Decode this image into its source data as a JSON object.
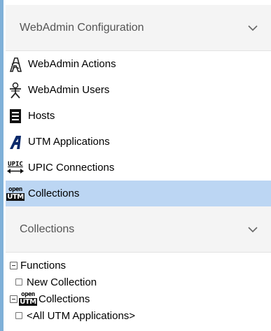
{
  "config_section": {
    "title": "WebAdmin Configuration",
    "items": [
      {
        "label": "WebAdmin Actions",
        "icon": "webadmin-actions-icon"
      },
      {
        "label": "WebAdmin Users",
        "icon": "webadmin-users-icon"
      },
      {
        "label": "Hosts",
        "icon": "hosts-icon"
      },
      {
        "label": "UTM Applications",
        "icon": "utm-applications-icon"
      },
      {
        "label": "UPIC Connections",
        "icon": "upic-connections-icon"
      },
      {
        "label": "Collections",
        "icon": "openutm-collections-icon",
        "selected": true
      }
    ]
  },
  "collections_section": {
    "title": "Collections",
    "tree": [
      {
        "label": "Functions",
        "children": [
          {
            "label": "New Collection"
          }
        ]
      },
      {
        "label": "Collections",
        "icon": "openutm-icon",
        "children": [
          {
            "label": "<All UTM Applications>"
          }
        ]
      }
    ]
  },
  "icons": {
    "openutm_top": "open",
    "openutm_bottom": "UTM",
    "upic_text": "UPIC"
  },
  "colors": {
    "selected_bg": "#bcd6f3",
    "header_bg": "#f4f4f4",
    "left_bar": "#7fb0d8"
  }
}
